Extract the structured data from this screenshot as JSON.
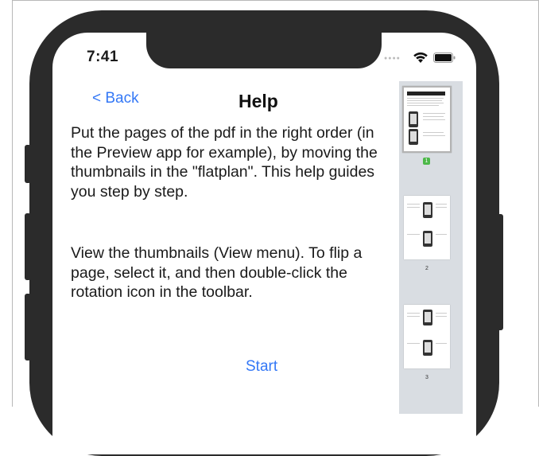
{
  "status_bar": {
    "time": "7:41"
  },
  "nav": {
    "back_label": "< Back",
    "title": "Help"
  },
  "content": {
    "paragraphs": [
      "Put the pages of the pdf in the right order (in the Preview app for example), by moving the thumbnails in the \"flatplan\". This help guides you step by step.",
      "View the thumbnails (View menu). To flip a page, select it, and then double-click the rotation icon in the toolbar."
    ],
    "start_label": "Start"
  },
  "thumbnails": [
    {
      "page": "1",
      "selected": true
    },
    {
      "page": "2",
      "selected": false
    },
    {
      "page": "3",
      "selected": false
    }
  ],
  "colors": {
    "accent": "#3478f6",
    "badge": "#4cb848",
    "device": "#2b2b2b"
  }
}
